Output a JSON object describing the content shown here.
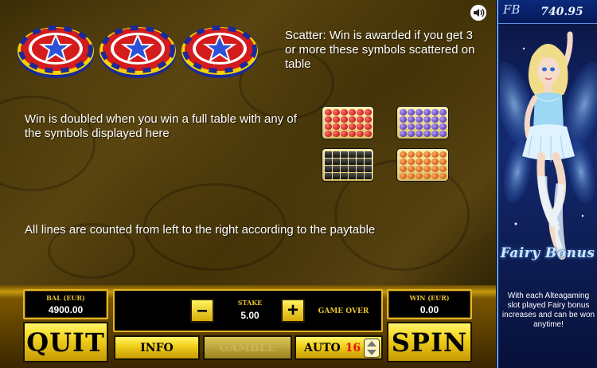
{
  "side": {
    "logo": "FB",
    "balance_display": "740.95",
    "fairy_title": "Fairy Bonus",
    "message": "With each Alteagaming slot played Fairy bonus increases and can be won anytime!"
  },
  "rules": {
    "scatter_text": "Scatter: Win is awarded if you get 3 or more these symbols scattered on table",
    "full_table_text": "Win is doubled when you win a full table with any of the symbols displayed here",
    "lines_text": "All lines are counted from left to the right according to the paytable"
  },
  "symbols": {
    "scatter": "star-chip-icon",
    "full_table": [
      "cherry-table-icon",
      "plum-table-icon",
      "bar-table-icon",
      "seven-table-icon"
    ]
  },
  "controls": {
    "balance_label": "BAL (EUR)",
    "balance_value": "4900.00",
    "stake_label": "STAKE",
    "stake_value": "5.00",
    "status": "GAME OVER",
    "win_label": "WIN (EUR)",
    "win_value": "0.00",
    "quit_label": "QUIT",
    "info_label": "INFO",
    "gamble_label": "GAMBLE",
    "auto_label": "AUTO",
    "auto_count": "16",
    "spin_label": "SPIN",
    "minus_label": "–",
    "plus_label": "+"
  },
  "colors": {
    "accent_gold": "#f2d21e",
    "label_gold": "#e7c12c",
    "auto_count": "#e8101b",
    "side_panel": "#142a70"
  }
}
